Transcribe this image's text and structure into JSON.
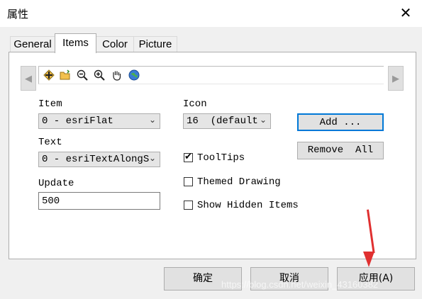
{
  "window": {
    "title": "属性",
    "close_symbol": "✕"
  },
  "tabs": [
    {
      "label": "General"
    },
    {
      "label": "Items",
      "active": true
    },
    {
      "label": "Color"
    },
    {
      "label": "Picture"
    }
  ],
  "toolbar": {
    "scroll_left_symbol": "◀",
    "scroll_right_symbol": "▶",
    "tools": [
      "add-item-icon",
      "open-folder-icon",
      "zoom-out-icon",
      "zoom-in-icon",
      "pan-hand-icon",
      "globe-icon"
    ]
  },
  "form": {
    "item_label": "Item",
    "item_value": "0 - esriFlat",
    "text_label": "Text",
    "text_value": "0 - esriTextAlongS",
    "update_label": "Update",
    "update_value": "500",
    "icon_label": "Icon",
    "icon_value": "16  (default",
    "tooltips_label": "ToolTips",
    "tooltips_checked": true,
    "themed_label": "Themed Drawing",
    "themed_checked": false,
    "hidden_label": "Show Hidden Items",
    "hidden_checked": false,
    "add_label": "Add ...",
    "remove_all_label": "Remove  All"
  },
  "footer": {
    "ok_label": "确定",
    "cancel_label": "取消",
    "apply_label": "应用(A)"
  },
  "watermark": "https://blog.csdn.net/weixin_43160382",
  "colors": {
    "annotation_arrow": "#e03030",
    "focus_border": "#0078d7"
  }
}
